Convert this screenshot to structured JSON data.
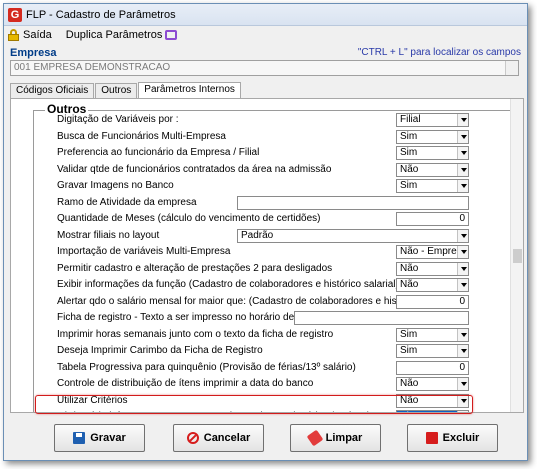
{
  "window": {
    "title": "FLP - Cadastro de Parâmetros",
    "icon": "G"
  },
  "toolbar": {
    "exit_label": "Saída",
    "duplicate_label": "Duplica Parâmetros"
  },
  "empresa": {
    "label": "Empresa",
    "hint": "\"CTRL + L\" para localizar os campos",
    "value": "001 EMPRESA DEMONSTRACAO"
  },
  "tabs": [
    {
      "label": "Códigos Oficiais"
    },
    {
      "label": "Outros"
    },
    {
      "label": "Parâmetros Internos"
    }
  ],
  "group": {
    "legend": "Outros"
  },
  "rows": [
    {
      "label": "Digitação de Variáveis por :",
      "value": "Filial",
      "kind": "select"
    },
    {
      "label": "Busca de Funcionários Multi-Empresa",
      "value": "Sim",
      "kind": "select"
    },
    {
      "label": "Preferencia ao funcionário da Empresa / Filial",
      "value": "Sim",
      "kind": "select"
    },
    {
      "label": "Validar qtde de funcionários contratados da área na admissão",
      "value": "Não",
      "kind": "select"
    },
    {
      "label": "Gravar Imagens no Banco",
      "value": "Sim",
      "kind": "select"
    },
    {
      "label": "Ramo de Atividade da empresa",
      "value": "",
      "kind": "text"
    },
    {
      "label": "Quantidade de Meses (cálculo do vencimento de certidões)",
      "value": "0",
      "kind": "number"
    },
    {
      "label": "Mostrar filiais no layout",
      "value": "Padrão",
      "kind": "select-wide"
    },
    {
      "label": "Importação de variáveis Multi-Empresa",
      "value": "Não - Empresa",
      "kind": "select"
    },
    {
      "label": "Permitir cadastro e alteração de prestações 2 para desligados",
      "value": "Não",
      "kind": "select"
    },
    {
      "label": "Exibir informações da função (Cadastro de colaboradores e histórico salarial)",
      "value": "Não",
      "kind": "select"
    },
    {
      "label": "Alertar qdo o salário mensal for maior que: (Cadastro de colaboradores e histórico salarial)",
      "value": "0",
      "kind": "number"
    },
    {
      "label": "Ficha de registro - Texto a ser impresso no horário de trabalho",
      "value": "",
      "kind": "text-short"
    },
    {
      "label": "Imprimir horas semanais junto com o texto da ficha de registro",
      "value": "Sim",
      "kind": "select"
    },
    {
      "label": "Deseja Imprimir Carimbo da Ficha de Registro",
      "value": "Sim",
      "kind": "select"
    },
    {
      "label": "Tabela Progressiva para quinquênio (Provisão de férias/13º salário)",
      "value": "0",
      "kind": "number"
    },
    {
      "label": "Controle de distribuição de ítens imprimir a data do banco",
      "value": "Não",
      "kind": "select"
    },
    {
      "label": "Utilizar Critérios",
      "value": "Não",
      "kind": "select"
    },
    {
      "label": "Obrigatório informar PIS, CTPS no Cadastro de Funcionários / Pró-Labores / Aut.",
      "value": "Sim",
      "kind": "select-highlight"
    }
  ],
  "buttons": {
    "save": "Gravar",
    "cancel": "Cancelar",
    "clear": "Limpar",
    "delete": "Excluir"
  }
}
